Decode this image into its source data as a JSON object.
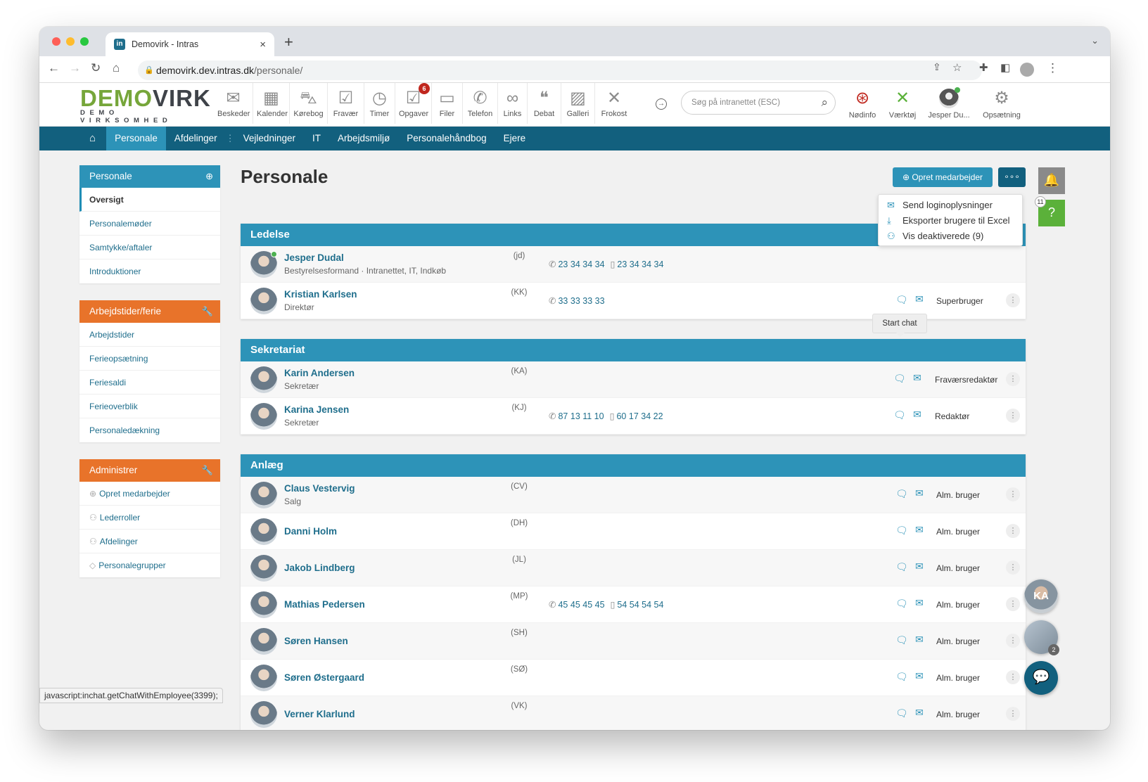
{
  "browser": {
    "tab_title": "Demovirk - Intras",
    "url_host": "demovirk.dev.intras.dk",
    "url_path": "/personale/"
  },
  "logo": {
    "text_a": "DEMO",
    "text_b": "VIRK",
    "sub": "DEMO VIRKSOMHED"
  },
  "topbar": {
    "items": [
      {
        "label": "Beskeder",
        "icon": "envelope-icon",
        "glyph": "✉"
      },
      {
        "label": "Kalender",
        "icon": "calendar-icon",
        "glyph": "▦"
      },
      {
        "label": "Kørebog",
        "icon": "car-icon",
        "glyph": "⛍"
      },
      {
        "label": "Fravær",
        "icon": "calendar-check-icon",
        "glyph": "☑"
      },
      {
        "label": "Timer",
        "icon": "clock-icon",
        "glyph": "◷"
      },
      {
        "label": "Opgaver",
        "icon": "checkbox-icon",
        "glyph": "☑",
        "badge": "6"
      },
      {
        "label": "Filer",
        "icon": "folder-icon",
        "glyph": "▭"
      },
      {
        "label": "Telefon",
        "icon": "phone-icon",
        "glyph": "✆"
      },
      {
        "label": "Links",
        "icon": "link-icon",
        "glyph": "∞"
      },
      {
        "label": "Debat",
        "icon": "chat-icon",
        "glyph": "❝"
      },
      {
        "label": "Galleri",
        "icon": "image-icon",
        "glyph": "▨"
      },
      {
        "label": "Frokost",
        "icon": "cutlery-icon",
        "glyph": "✕"
      }
    ],
    "search_placeholder": "Søg på intranettet (ESC)",
    "right": [
      {
        "label": "Nødinfo",
        "icon": "lifebuoy-icon",
        "glyph": "⊛",
        "color": "#c0271e"
      },
      {
        "label": "Værktøj",
        "icon": "tools-icon",
        "glyph": "✕",
        "color": "#5bb13a"
      },
      {
        "label": "Jesper Du...",
        "icon": "user-avatar"
      },
      {
        "label": "Opsætning",
        "icon": "gears-icon",
        "glyph": "⚙",
        "color": "#8c8c8c"
      }
    ]
  },
  "nav": {
    "items": [
      "Personale",
      "Afdelinger",
      "Vejledninger",
      "IT",
      "Arbejdsmiljø",
      "Personalehåndbog",
      "Ejere"
    ],
    "active": "Personale"
  },
  "sidebar": [
    {
      "title": "Personale",
      "color": "#2d93b8",
      "icon": "plus-circle-icon",
      "items": [
        "Oversigt",
        "Personalemøder",
        "Samtykke/aftaler",
        "Introduktioner"
      ],
      "selected": 0
    },
    {
      "title": "Arbejdstider/ferie",
      "color": "#e8732a",
      "icon": "wrench-icon",
      "items": [
        "Arbejdstider",
        "Ferieopsætning",
        "Feriesaldi",
        "Ferieoverblik",
        "Personaledækning"
      ]
    },
    {
      "title": "Administrer",
      "color": "#e8732a",
      "icon": "wrench-icon",
      "items": [
        "Opret medarbejder",
        "Lederroller",
        "Afdelinger",
        "Personalegrupper"
      ]
    }
  ],
  "page": {
    "title": "Personale",
    "create_button": "Opret medarbejder",
    "more_button": "∘∘∘"
  },
  "dropdown": [
    "Send loginoplysninger",
    "Eksporter brugere til Excel",
    "Vis deaktiverede (9)"
  ],
  "tooltip": "Start chat",
  "groups": [
    {
      "name": "Ledelse",
      "rows": [
        {
          "name": "Jesper Dudal",
          "title": "Bestyrelsesformand · Intranettet, IT, Indkøb",
          "initials": "(jd)",
          "phone": "23 34 34 34",
          "mobile": "23 34 34 34",
          "role": "",
          "online": true
        },
        {
          "name": "Kristian Karlsen",
          "title": "Direktør",
          "initials": "(KK)",
          "phone": "33 33 33 33",
          "mobile": "",
          "role": "Superbruger"
        }
      ]
    },
    {
      "name": "Sekretariat",
      "rows": [
        {
          "name": "Karin Andersen",
          "title": "Sekretær",
          "initials": "(KA)",
          "phone": "",
          "mobile": "",
          "role": "Fraværsredaktør"
        },
        {
          "name": "Karina Jensen",
          "title": "Sekretær",
          "initials": "(KJ)",
          "phone": "87 13 11 10",
          "mobile": "60 17 34 22",
          "role": "Redaktør"
        }
      ]
    },
    {
      "name": "Anlæg",
      "rows": [
        {
          "name": "Claus Vestervig",
          "title": "Salg",
          "initials": "(CV)",
          "phone": "",
          "mobile": "",
          "role": "Alm. bruger"
        },
        {
          "name": "Danni Holm",
          "title": "",
          "initials": "(DH)",
          "phone": "",
          "mobile": "",
          "role": "Alm. bruger"
        },
        {
          "name": "Jakob Lindberg",
          "title": "",
          "initials": "(JL)",
          "phone": "",
          "mobile": "",
          "role": "Alm. bruger"
        },
        {
          "name": "Mathias Pedersen",
          "title": "",
          "initials": "(MP)",
          "phone": "45 45 45 45",
          "mobile": "54 54 54 54",
          "role": "Alm. bruger"
        },
        {
          "name": "Søren Hansen",
          "title": "",
          "initials": "(SH)",
          "phone": "",
          "mobile": "",
          "role": "Alm. bruger"
        },
        {
          "name": "Søren Østergaard",
          "title": "",
          "initials": "(SØ)",
          "phone": "",
          "mobile": "",
          "role": "Alm. bruger"
        },
        {
          "name": "Verner Klarlund",
          "title": "",
          "initials": "(VK)",
          "phone": "",
          "mobile": "",
          "role": "Alm. bruger"
        }
      ]
    }
  ],
  "right_panel": {
    "help_badge": "11",
    "chat_initials": "KA",
    "chat_count": "2"
  },
  "status_bar": "javascript:inchat.getChatWithEmployee(3399);"
}
